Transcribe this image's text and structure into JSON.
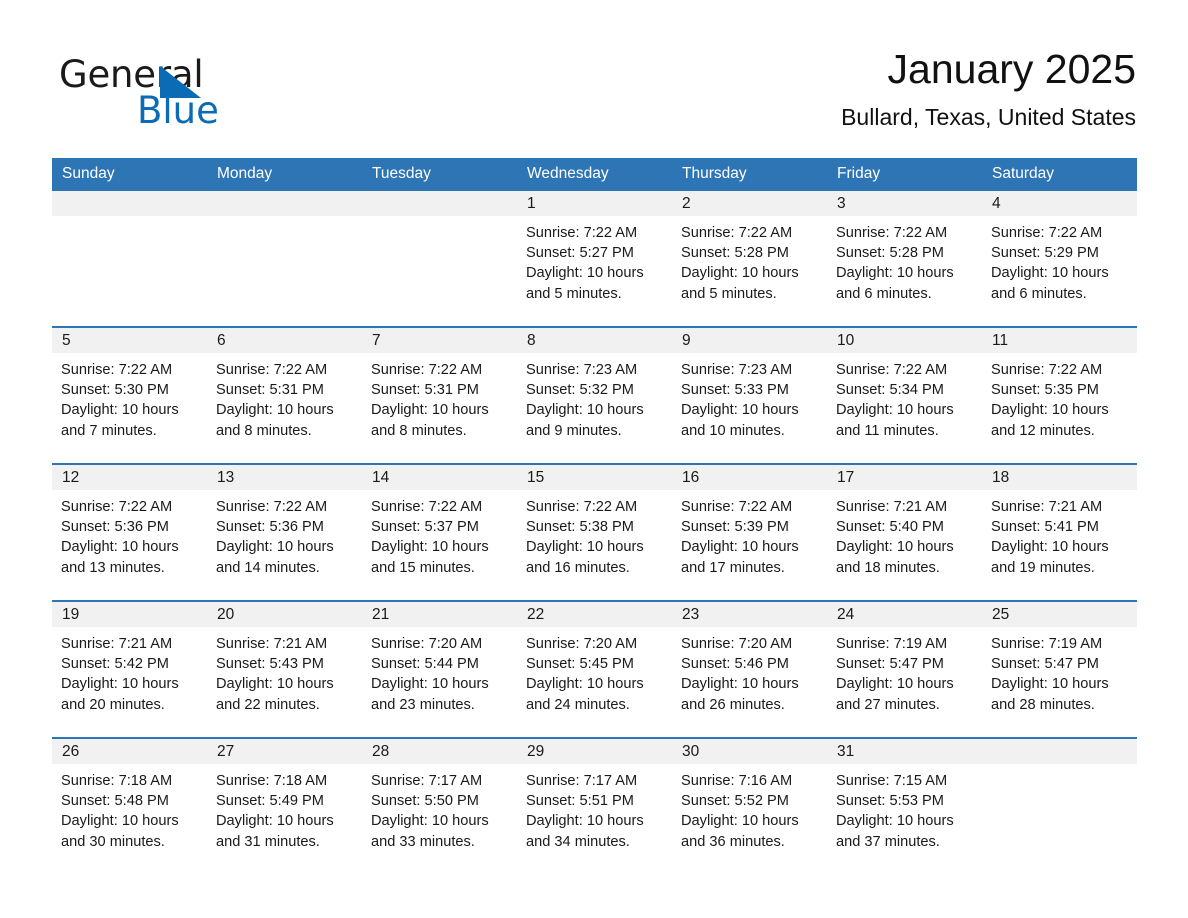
{
  "brand": {
    "name_part1": "General",
    "name_part2": "Blue",
    "triangle_color": "#0b6cb5",
    "text_color": "#1a1a1a"
  },
  "header": {
    "title": "January 2025",
    "location": "Bullard, Texas, United States"
  },
  "theme": {
    "header_blue": "#2e75b6",
    "day_band_gray": "#f1f1f1",
    "text": "#1a1a1a",
    "header_text": "#ffffff"
  },
  "weekdays": [
    "Sunday",
    "Monday",
    "Tuesday",
    "Wednesday",
    "Thursday",
    "Friday",
    "Saturday"
  ],
  "weeks": [
    [
      {
        "day": "",
        "sunrise": "",
        "sunset": "",
        "daylight": "",
        "empty": true
      },
      {
        "day": "",
        "sunrise": "",
        "sunset": "",
        "daylight": "",
        "empty": true
      },
      {
        "day": "",
        "sunrise": "",
        "sunset": "",
        "daylight": "",
        "empty": true
      },
      {
        "day": "1",
        "sunrise": "Sunrise: 7:22 AM",
        "sunset": "Sunset: 5:27 PM",
        "daylight": "Daylight: 10 hours and 5 minutes."
      },
      {
        "day": "2",
        "sunrise": "Sunrise: 7:22 AM",
        "sunset": "Sunset: 5:28 PM",
        "daylight": "Daylight: 10 hours and 5 minutes."
      },
      {
        "day": "3",
        "sunrise": "Sunrise: 7:22 AM",
        "sunset": "Sunset: 5:28 PM",
        "daylight": "Daylight: 10 hours and 6 minutes."
      },
      {
        "day": "4",
        "sunrise": "Sunrise: 7:22 AM",
        "sunset": "Sunset: 5:29 PM",
        "daylight": "Daylight: 10 hours and 6 minutes."
      }
    ],
    [
      {
        "day": "5",
        "sunrise": "Sunrise: 7:22 AM",
        "sunset": "Sunset: 5:30 PM",
        "daylight": "Daylight: 10 hours and 7 minutes."
      },
      {
        "day": "6",
        "sunrise": "Sunrise: 7:22 AM",
        "sunset": "Sunset: 5:31 PM",
        "daylight": "Daylight: 10 hours and 8 minutes."
      },
      {
        "day": "7",
        "sunrise": "Sunrise: 7:22 AM",
        "sunset": "Sunset: 5:31 PM",
        "daylight": "Daylight: 10 hours and 8 minutes."
      },
      {
        "day": "8",
        "sunrise": "Sunrise: 7:23 AM",
        "sunset": "Sunset: 5:32 PM",
        "daylight": "Daylight: 10 hours and 9 minutes."
      },
      {
        "day": "9",
        "sunrise": "Sunrise: 7:23 AM",
        "sunset": "Sunset: 5:33 PM",
        "daylight": "Daylight: 10 hours and 10 minutes."
      },
      {
        "day": "10",
        "sunrise": "Sunrise: 7:22 AM",
        "sunset": "Sunset: 5:34 PM",
        "daylight": "Daylight: 10 hours and 11 minutes."
      },
      {
        "day": "11",
        "sunrise": "Sunrise: 7:22 AM",
        "sunset": "Sunset: 5:35 PM",
        "daylight": "Daylight: 10 hours and 12 minutes."
      }
    ],
    [
      {
        "day": "12",
        "sunrise": "Sunrise: 7:22 AM",
        "sunset": "Sunset: 5:36 PM",
        "daylight": "Daylight: 10 hours and 13 minutes."
      },
      {
        "day": "13",
        "sunrise": "Sunrise: 7:22 AM",
        "sunset": "Sunset: 5:36 PM",
        "daylight": "Daylight: 10 hours and 14 minutes."
      },
      {
        "day": "14",
        "sunrise": "Sunrise: 7:22 AM",
        "sunset": "Sunset: 5:37 PM",
        "daylight": "Daylight: 10 hours and 15 minutes."
      },
      {
        "day": "15",
        "sunrise": "Sunrise: 7:22 AM",
        "sunset": "Sunset: 5:38 PM",
        "daylight": "Daylight: 10 hours and 16 minutes."
      },
      {
        "day": "16",
        "sunrise": "Sunrise: 7:22 AM",
        "sunset": "Sunset: 5:39 PM",
        "daylight": "Daylight: 10 hours and 17 minutes."
      },
      {
        "day": "17",
        "sunrise": "Sunrise: 7:21 AM",
        "sunset": "Sunset: 5:40 PM",
        "daylight": "Daylight: 10 hours and 18 minutes."
      },
      {
        "day": "18",
        "sunrise": "Sunrise: 7:21 AM",
        "sunset": "Sunset: 5:41 PM",
        "daylight": "Daylight: 10 hours and 19 minutes."
      }
    ],
    [
      {
        "day": "19",
        "sunrise": "Sunrise: 7:21 AM",
        "sunset": "Sunset: 5:42 PM",
        "daylight": "Daylight: 10 hours and 20 minutes."
      },
      {
        "day": "20",
        "sunrise": "Sunrise: 7:21 AM",
        "sunset": "Sunset: 5:43 PM",
        "daylight": "Daylight: 10 hours and 22 minutes."
      },
      {
        "day": "21",
        "sunrise": "Sunrise: 7:20 AM",
        "sunset": "Sunset: 5:44 PM",
        "daylight": "Daylight: 10 hours and 23 minutes."
      },
      {
        "day": "22",
        "sunrise": "Sunrise: 7:20 AM",
        "sunset": "Sunset: 5:45 PM",
        "daylight": "Daylight: 10 hours and 24 minutes."
      },
      {
        "day": "23",
        "sunrise": "Sunrise: 7:20 AM",
        "sunset": "Sunset: 5:46 PM",
        "daylight": "Daylight: 10 hours and 26 minutes."
      },
      {
        "day": "24",
        "sunrise": "Sunrise: 7:19 AM",
        "sunset": "Sunset: 5:47 PM",
        "daylight": "Daylight: 10 hours and 27 minutes."
      },
      {
        "day": "25",
        "sunrise": "Sunrise: 7:19 AM",
        "sunset": "Sunset: 5:47 PM",
        "daylight": "Daylight: 10 hours and 28 minutes."
      }
    ],
    [
      {
        "day": "26",
        "sunrise": "Sunrise: 7:18 AM",
        "sunset": "Sunset: 5:48 PM",
        "daylight": "Daylight: 10 hours and 30 minutes."
      },
      {
        "day": "27",
        "sunrise": "Sunrise: 7:18 AM",
        "sunset": "Sunset: 5:49 PM",
        "daylight": "Daylight: 10 hours and 31 minutes."
      },
      {
        "day": "28",
        "sunrise": "Sunrise: 7:17 AM",
        "sunset": "Sunset: 5:50 PM",
        "daylight": "Daylight: 10 hours and 33 minutes."
      },
      {
        "day": "29",
        "sunrise": "Sunrise: 7:17 AM",
        "sunset": "Sunset: 5:51 PM",
        "daylight": "Daylight: 10 hours and 34 minutes."
      },
      {
        "day": "30",
        "sunrise": "Sunrise: 7:16 AM",
        "sunset": "Sunset: 5:52 PM",
        "daylight": "Daylight: 10 hours and 36 minutes."
      },
      {
        "day": "31",
        "sunrise": "Sunrise: 7:15 AM",
        "sunset": "Sunset: 5:53 PM",
        "daylight": "Daylight: 10 hours and 37 minutes."
      },
      {
        "day": "",
        "sunrise": "",
        "sunset": "",
        "daylight": "",
        "empty": true
      }
    ]
  ]
}
